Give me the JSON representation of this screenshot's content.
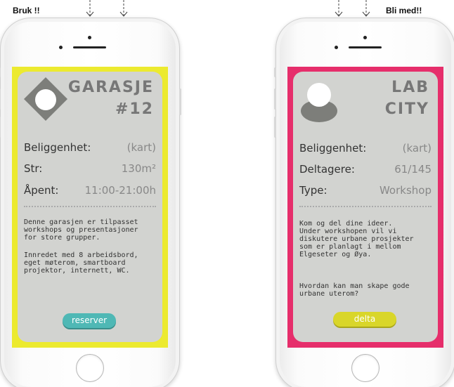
{
  "labels": {
    "left": "Bruk !!",
    "right": "Bli med!!"
  },
  "colors": {
    "left_frame": "#ecea2f",
    "right_frame": "#e62e6b",
    "card": "#d2d3d0",
    "reserve_button": "#4fb8b5",
    "join_button": "#d9d62a"
  },
  "left_card": {
    "icon": "diamond-circle-icon",
    "title_line1": "GARASJE",
    "title_line2": "#12",
    "rows": [
      {
        "key": "Beliggenhet:",
        "value": "(kart)"
      },
      {
        "key": "Str:",
        "value": "130m²"
      },
      {
        "key": "Åpent:",
        "value": "11:00-21:00h"
      }
    ],
    "paragraph1": "Denne garasjen er tilpasset\nworkshops og presentasjoner\nfor store grupper.",
    "paragraph2": "Innredet med 8 arbeidsbord,\neget møterom, smartboard\nprojektor, internett, WC.",
    "button": "reserver"
  },
  "right_card": {
    "icon": "person-avatar-icon",
    "title_line1": "LAB",
    "title_line2": "CITY",
    "rows": [
      {
        "key": "Beliggenhet:",
        "value": "(kart)"
      },
      {
        "key": "Deltagere:",
        "value": "61/145"
      },
      {
        "key": "Type:",
        "value": "Workshop"
      }
    ],
    "paragraph1": "Kom og del dine ideer.\nUnder workshopen vil vi\ndiskutere urbane prosjekter\nsom er planlagt i mellom\nElgeseter og Øya.",
    "paragraph2": "Hvordan kan man skape gode\nurbane uterom?",
    "button": "delta"
  }
}
